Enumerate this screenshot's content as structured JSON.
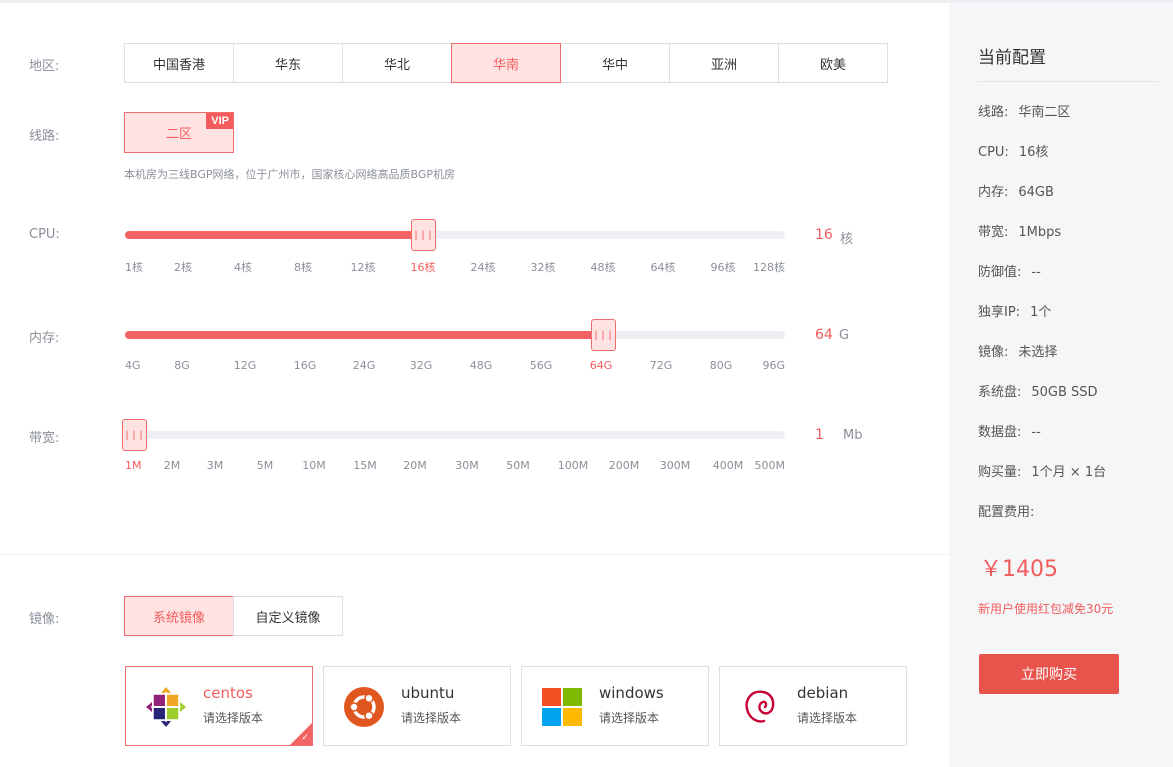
{
  "region": {
    "label": "地区:",
    "options": [
      "中国香港",
      "华东",
      "华北",
      "华南",
      "华中",
      "亚洲",
      "欧美"
    ],
    "selected": "华南"
  },
  "line": {
    "label": "线路:",
    "option": "二区",
    "badge": "VIP",
    "note": "本机房为三线BGP网络，位于广州市，国家核心网络高品质BGP机房"
  },
  "cpu": {
    "label": "CPU:",
    "ticks": [
      "1核",
      "2核",
      "4核",
      "8核",
      "12核",
      "16核",
      "24核",
      "32核",
      "48核",
      "64核",
      "96核",
      "128核"
    ],
    "selected_index": 5,
    "value": "16",
    "unit": "核",
    "handle_glyph": "|||"
  },
  "memory": {
    "label": "内存:",
    "ticks": [
      "4G",
      "8G",
      "12G",
      "16G",
      "24G",
      "32G",
      "48G",
      "56G",
      "64G",
      "72G",
      "80G",
      "96G"
    ],
    "selected_index": 8,
    "value": "64",
    "unit": "G",
    "handle_glyph": "|||"
  },
  "bandwidth": {
    "label": "带宽:",
    "ticks": [
      "1M",
      "2M",
      "3M",
      "5M",
      "10M",
      "15M",
      "20M",
      "30M",
      "50M",
      "100M",
      "200M",
      "300M",
      "400M",
      "500M"
    ],
    "selected_index": 0,
    "value": "1",
    "unit": "Mb",
    "handle_glyph": "|||"
  },
  "image": {
    "label": "镜像:",
    "tabs": [
      "系统镜像",
      "自定义镜像"
    ],
    "selected_tab": "系统镜像",
    "os": [
      {
        "name": "centos",
        "sub": "请选择版本",
        "icon": "centos-icon",
        "selected": true
      },
      {
        "name": "ubuntu",
        "sub": "请选择版本",
        "icon": "ubuntu-icon",
        "selected": false
      },
      {
        "name": "windows",
        "sub": "请选择版本",
        "icon": "windows-icon",
        "selected": false
      },
      {
        "name": "debian",
        "sub": "请选择版本",
        "icon": "debian-icon",
        "selected": false
      }
    ],
    "check_glyph": "✓"
  },
  "summary": {
    "title": "当前配置",
    "rows": [
      {
        "k": "线路:",
        "v": "华南二区"
      },
      {
        "k": "CPU:",
        "v": "16核"
      },
      {
        "k": "内存:",
        "v": "64GB"
      },
      {
        "k": "带宽:",
        "v": "1Mbps"
      },
      {
        "k": "防御值:",
        "v": "--"
      },
      {
        "k": "独享IP:",
        "v": "1个"
      },
      {
        "k": "镜像:",
        "v": "未选择"
      },
      {
        "k": "系统盘:",
        "v": "50GB SSD"
      },
      {
        "k": "数据盘:",
        "v": "--"
      },
      {
        "k": "购买量:",
        "v": "1个月 × 1台"
      },
      {
        "k": "配置费用:",
        "v": ""
      }
    ],
    "price": "￥1405",
    "promo": "新用户使用红包减免30元",
    "buy_label": "立即购买"
  },
  "colors": {
    "accent": "#f25c5c",
    "accent_bg": "#ffe3e3",
    "button": "#e8534c",
    "sidebar_bg": "#f5f6f8"
  }
}
